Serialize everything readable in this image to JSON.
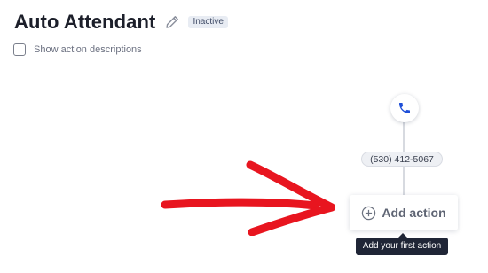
{
  "header": {
    "title": "Auto Attendant",
    "edit_icon": "pencil-icon",
    "status": "Inactive"
  },
  "options": {
    "show_descriptions_label": "Show action descriptions",
    "show_descriptions_checked": false
  },
  "flow": {
    "start_icon": "phone-icon",
    "phone_number": "(530) 412-5067",
    "add_action_icon": "plus-circle-icon",
    "add_action_label": "Add action",
    "tooltip": "Add your first action"
  },
  "colors": {
    "phone_icon": "#1f4fd8",
    "annotation_arrow": "#e8151f",
    "tooltip_bg": "#1f2536",
    "badge_bg": "#e8ecf3"
  }
}
